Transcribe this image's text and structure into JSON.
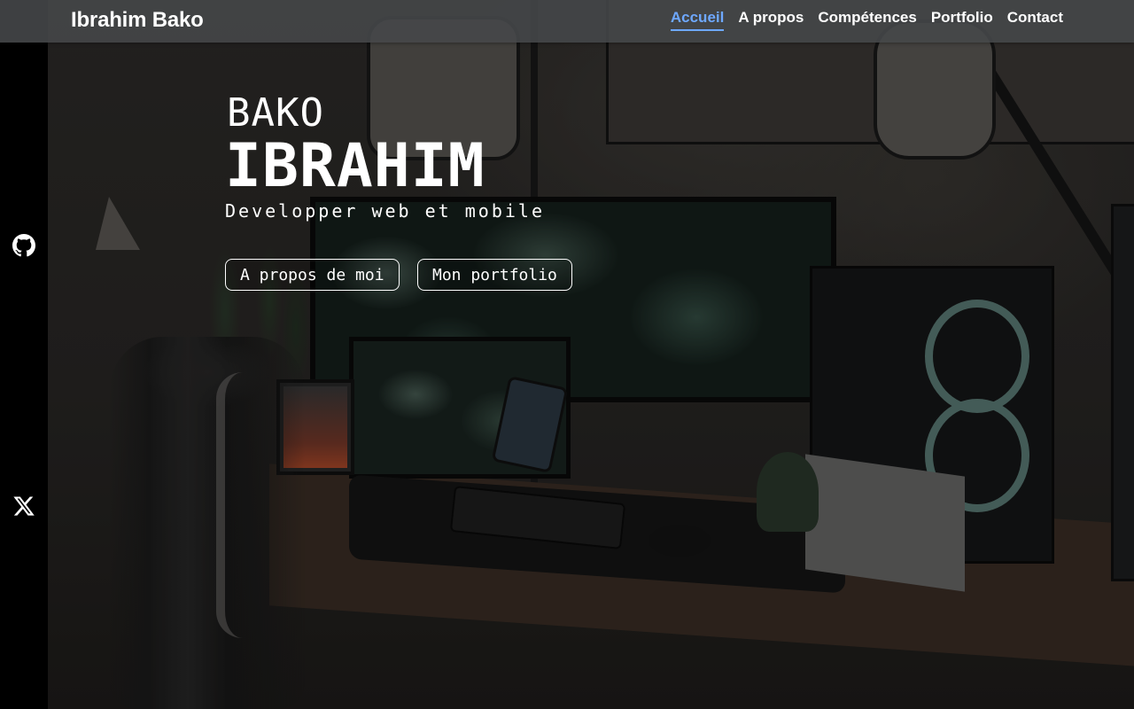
{
  "navbar": {
    "brand": "Ibrahim Bako",
    "links": [
      {
        "label": "Accueil",
        "active": true
      },
      {
        "label": "A propos",
        "active": false
      },
      {
        "label": "Compétences",
        "active": false
      },
      {
        "label": "Portfolio",
        "active": false
      },
      {
        "label": "Contact",
        "active": false
      }
    ]
  },
  "hero": {
    "first_name": "BAKO",
    "last_name": "IBRAHIM",
    "tagline": "Developper web et mobile",
    "buttons": {
      "about": "A propos de moi",
      "portfolio": "Mon portfolio"
    }
  },
  "social": {
    "items": [
      {
        "icon": "github-icon"
      },
      {
        "icon": "x-twitter-icon"
      }
    ]
  },
  "colors": {
    "accent": "#6ea8ff",
    "navbar_bg": "#46484a",
    "rail_bg": "#000000",
    "text": "#ffffff"
  }
}
